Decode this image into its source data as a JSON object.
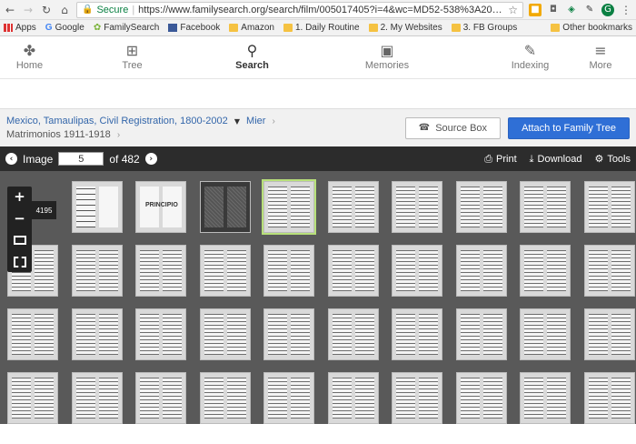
{
  "browser": {
    "secure_label": "Secure",
    "url": "https://www.familysearch.org/search/film/005017405?i=4&wc=MD52-538%3A2034...",
    "bookmarks": [
      {
        "label": "Apps"
      },
      {
        "label": "Google"
      },
      {
        "label": "FamilySearch"
      },
      {
        "label": "Facebook"
      },
      {
        "label": "Amazon"
      },
      {
        "label": "1. Daily Routine"
      },
      {
        "label": "2. My Websites"
      },
      {
        "label": "3. FB Groups"
      }
    ],
    "other_bookmarks": "Other bookmarks"
  },
  "nav": {
    "home": "Home",
    "tree": "Tree",
    "search": "Search",
    "memories": "Memories",
    "indexing": "Indexing",
    "more": "More"
  },
  "breadcrumb": {
    "collection": "Mexico, Tamaulipas, Civil Registration, 1800-2002",
    "place": "Mier",
    "subset": "Matrimonios 1911-1918"
  },
  "actions": {
    "source_box": "Source Box",
    "attach": "Attach to Family Tree"
  },
  "viewer": {
    "image_label": "Image",
    "image_number": "5",
    "of_total": "of 482",
    "print": "Print",
    "download": "Download",
    "tools": "Tools",
    "number_tag": "4195",
    "cover_label": "PRINCIPIO",
    "selected_index": 4
  },
  "colors": {
    "accent": "#2f6fd6",
    "link": "#3366aa",
    "selected_outline": "#b8e07a",
    "viewer_bg": "#595959"
  }
}
